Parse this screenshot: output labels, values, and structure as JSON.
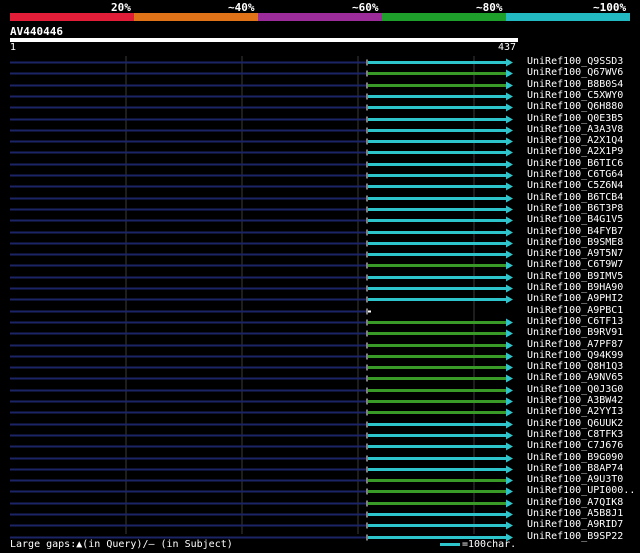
{
  "identity_scale": {
    "labels": [
      "20%",
      "~40%",
      "~60%",
      "~80%",
      "~100%"
    ],
    "colors": [
      "#e21d38",
      "#e07318",
      "#9c2c99",
      "#1e9e2a",
      "#22b9c2"
    ]
  },
  "query": {
    "name": "AV440446",
    "start": "1",
    "end": "437"
  },
  "colors": {
    "cyan": "#2ec4cc",
    "green": "#3a9a28",
    "navy": "#1b2466",
    "white": "#ffffff",
    "grid": "#3a3a3a"
  },
  "hits": [
    {
      "label": "UniRef100_Q9SSD3",
      "color": "cyan"
    },
    {
      "label": "UniRef100_Q67WV6",
      "color": "green"
    },
    {
      "label": "UniRef100_B8B0S4",
      "color": "green"
    },
    {
      "label": "UniRef100_C5XWY0",
      "color": "cyan"
    },
    {
      "label": "UniRef100_Q6H880",
      "color": "cyan"
    },
    {
      "label": "UniRef100_Q0E3B5",
      "color": "cyan"
    },
    {
      "label": "UniRef100_A3A3V8",
      "color": "cyan"
    },
    {
      "label": "UniRef100_A2X1Q4",
      "color": "cyan"
    },
    {
      "label": "UniRef100_A2X1P9",
      "color": "cyan"
    },
    {
      "label": "UniRef100_B6TIC6",
      "color": "cyan"
    },
    {
      "label": "UniRef100_C6TG64",
      "color": "cyan"
    },
    {
      "label": "UniRef100_C5Z6N4",
      "color": "cyan"
    },
    {
      "label": "UniRef100_B6TCB4",
      "color": "cyan"
    },
    {
      "label": "UniRef100_B6T3P8",
      "color": "cyan"
    },
    {
      "label": "UniRef100_B4G1V5",
      "color": "cyan"
    },
    {
      "label": "UniRef100_B4FYB7",
      "color": "cyan"
    },
    {
      "label": "UniRef100_B9SME8",
      "color": "cyan"
    },
    {
      "label": "UniRef100_A9T5N7",
      "color": "cyan"
    },
    {
      "label": "UniRef100_C6T9W7",
      "color": "green"
    },
    {
      "label": "UniRef100_B9IMV5",
      "color": "cyan"
    },
    {
      "label": "UniRef100_B9HA90",
      "color": "cyan"
    },
    {
      "label": "UniRef100_A9PHI2",
      "color": "cyan"
    },
    {
      "label": "UniRef100_A9PBC1",
      "color": "white"
    },
    {
      "label": "UniRef100_C6TF13",
      "color": "green"
    },
    {
      "label": "UniRef100_B9RV91",
      "color": "green"
    },
    {
      "label": "UniRef100_A7PF87",
      "color": "green"
    },
    {
      "label": "UniRef100_Q94K99",
      "color": "green"
    },
    {
      "label": "UniRef100_Q8H1Q3",
      "color": "green"
    },
    {
      "label": "UniRef100_A9NV65",
      "color": "green"
    },
    {
      "label": "UniRef100_Q0J3G0",
      "color": "green"
    },
    {
      "label": "UniRef100_A3BW42",
      "color": "green"
    },
    {
      "label": "UniRef100_A2YYI3",
      "color": "green"
    },
    {
      "label": "UniRef100_Q6UUK2",
      "color": "cyan"
    },
    {
      "label": "UniRef100_C8TFK3",
      "color": "cyan"
    },
    {
      "label": "UniRef100_C7J676",
      "color": "cyan"
    },
    {
      "label": "UniRef100_B9G090",
      "color": "cyan"
    },
    {
      "label": "UniRef100_B8AP74",
      "color": "cyan"
    },
    {
      "label": "UniRef100_A9U3T0",
      "color": "green"
    },
    {
      "label": "UniRef100_UPI000..",
      "color": "green"
    },
    {
      "label": "UniRef100_A7QIK8",
      "color": "green"
    },
    {
      "label": "UniRef100_A5B8J1",
      "color": "cyan"
    },
    {
      "label": "UniRef100_A9RID7",
      "color": "cyan"
    },
    {
      "label": "UniRef100_B9SP22",
      "color": "cyan"
    }
  ],
  "legend": {
    "gaps_text": "Large gaps:▲(in Query)/– (in Subject)",
    "scale_text": "=100char."
  }
}
